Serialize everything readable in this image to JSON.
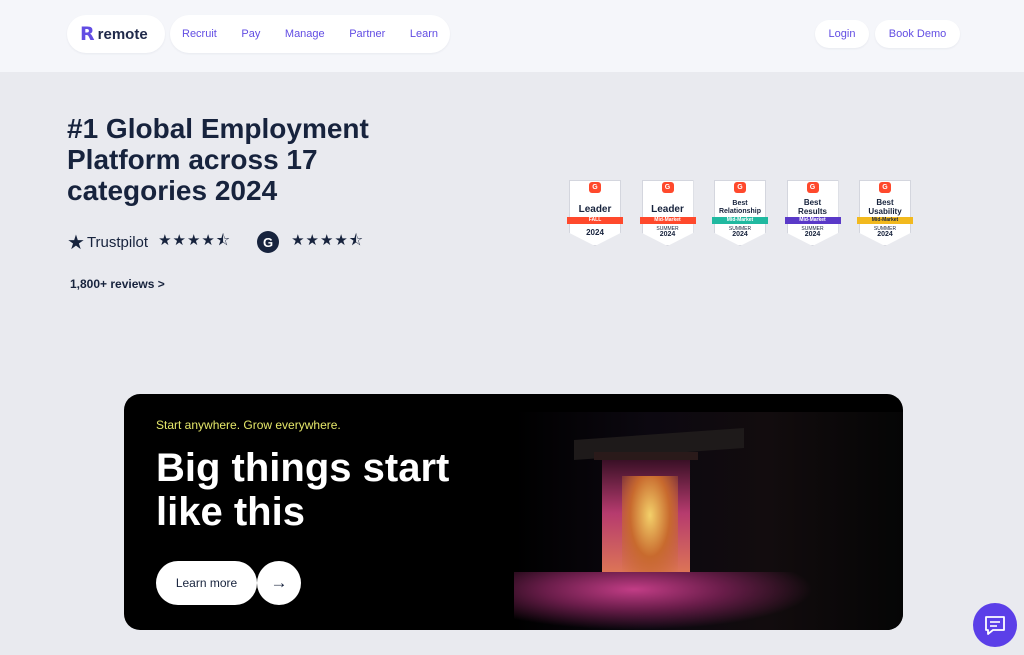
{
  "nav": {
    "logo_text": "remote",
    "items": [
      "Recruit",
      "Pay",
      "Manage",
      "Partner",
      "Learn"
    ],
    "login": "Login",
    "book_demo": "Book Demo"
  },
  "intro": {
    "headline": "#1 Global Employment Platform across 17 categories 2024",
    "trustpilot_label": "Trustpilot",
    "trustpilot_stars": "★★★★⯪",
    "g2_logo": "G",
    "g2_stars": "★★★★⯪",
    "reviews_link": "1,800+ reviews >"
  },
  "badges": [
    {
      "brand": "G",
      "line1": "Leader",
      "line2": "",
      "ribbon": "FALL",
      "season": "",
      "year": "2024",
      "color": "#ff492c"
    },
    {
      "brand": "G",
      "line1": "Leader",
      "line2": "",
      "ribbon": "Mid-Market",
      "season": "SUMMER",
      "year": "2024",
      "color": "#ff492c"
    },
    {
      "brand": "G",
      "line1": "Best",
      "line2": "Relationship",
      "ribbon": "Mid-Market",
      "season": "SUMMER",
      "year": "2024",
      "color": "#21b9a0"
    },
    {
      "brand": "G",
      "line1": "Best",
      "line2": "Results",
      "ribbon": "Mid-Market",
      "season": "SUMMER",
      "year": "2024",
      "color": "#5a39c8"
    },
    {
      "brand": "G",
      "line1": "Best",
      "line2": "Usability",
      "ribbon": "Mid-Market",
      "season": "SUMMER",
      "year": "2024",
      "color": "#f2b91e"
    }
  ],
  "hero": {
    "eyebrow": "Start anywhere. Grow everywhere.",
    "title": "Big things start like this",
    "learn_more": "Learn more",
    "arrow": "→"
  },
  "colors": {
    "brand": "#624de3",
    "chat": "#5b3fe8",
    "eyebrow": "#e6e86a"
  },
  "icons": {
    "chat": "chat-icon",
    "arrow": "arrow-right-icon"
  }
}
